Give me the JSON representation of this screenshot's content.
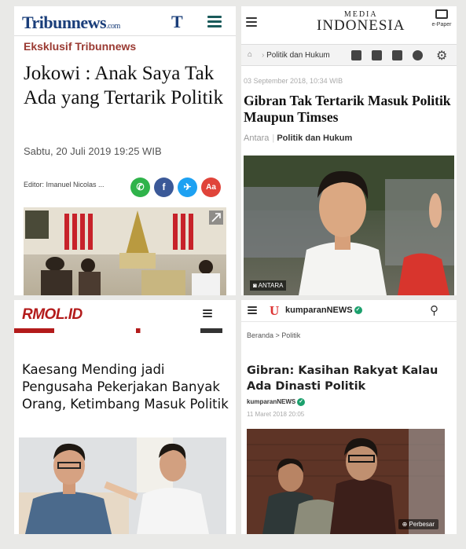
{
  "tribun": {
    "logo": "Tribunnews",
    "logo_suffix": ".com",
    "t_mark": "T",
    "kicker": "Eksklusif Tribunnews",
    "headline": "Jokowi : Anak Saya Tak Ada yang Tertarik Politik",
    "date": "Sabtu, 20 Juli 2019 19:25 WIB",
    "editor": "Editor: Imanuel Nicolas ...",
    "share_icons": [
      "whatsapp-icon",
      "facebook-icon",
      "twitter-icon",
      "font-size-icon"
    ],
    "share_font_label": "Aa",
    "brand_color": "#1a3e7a",
    "kicker_color": "#9a3a32",
    "menu_color": "#1a5a5a"
  },
  "mediaindonesia": {
    "logo_top": "MEDIA",
    "logo_bottom": "INDONESIA",
    "epaper": "e-Paper",
    "breadcrumb": "Politik dan Hukum",
    "date": "03 September 2018, 10:34 WIB",
    "headline": "Gibran Tak Tertarik Masuk Politik Maupun Timses",
    "source": "Antara",
    "category": "Politik dan Hukum",
    "photo_tag": "ANTARA",
    "social_icons": [
      "facebook-icon",
      "messenger-icon",
      "twitter-icon",
      "whatsapp-icon",
      "settings-icon"
    ]
  },
  "rmol": {
    "logo": "RMOL.ID",
    "headline": "Kaesang Mending jadi Pengusaha Pekerjakan Banyak Orang, Ketimbang Masuk Politik",
    "brand_color": "#b31b1b"
  },
  "kumparan": {
    "brand": "kumparanNEWS",
    "breadcrumb": "Beranda > Politik",
    "headline": "Gibran: Kasihan Rakyat Kalau Ada Dinasti Politik",
    "author": "kumparanNEWS",
    "date": "11 Maret 2018 20:05",
    "photo_tag": "Perbesar",
    "verified_color": "#1ca06d"
  }
}
